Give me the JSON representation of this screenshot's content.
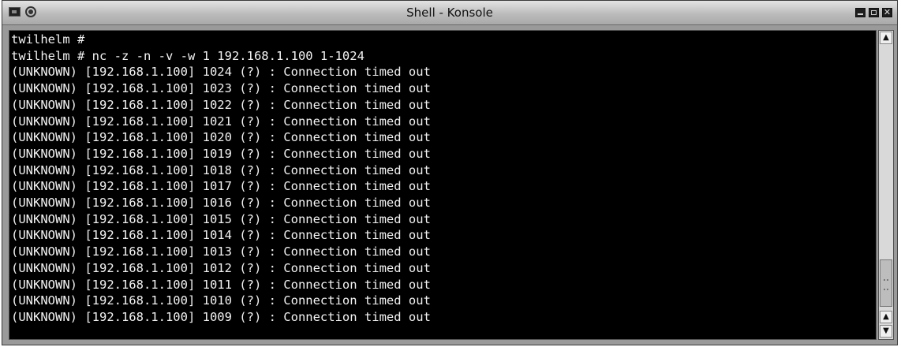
{
  "window": {
    "title": "Shell - Konsole",
    "controls": [
      "minimize",
      "maximize",
      "close"
    ],
    "close_glyph": "✕"
  },
  "terminal": {
    "lines": [
      "twilhelm #",
      "twilhelm # nc -z -n -v -w 1 192.168.1.100 1-1024",
      "(UNKNOWN) [192.168.1.100] 1024 (?) : Connection timed out",
      "(UNKNOWN) [192.168.1.100] 1023 (?) : Connection timed out",
      "(UNKNOWN) [192.168.1.100] 1022 (?) : Connection timed out",
      "(UNKNOWN) [192.168.1.100] 1021 (?) : Connection timed out",
      "(UNKNOWN) [192.168.1.100] 1020 (?) : Connection timed out",
      "(UNKNOWN) [192.168.1.100] 1019 (?) : Connection timed out",
      "(UNKNOWN) [192.168.1.100] 1018 (?) : Connection timed out",
      "(UNKNOWN) [192.168.1.100] 1017 (?) : Connection timed out",
      "(UNKNOWN) [192.168.1.100] 1016 (?) : Connection timed out",
      "(UNKNOWN) [192.168.1.100] 1015 (?) : Connection timed out",
      "(UNKNOWN) [192.168.1.100] 1014 (?) : Connection timed out",
      "(UNKNOWN) [192.168.1.100] 1013 (?) : Connection timed out",
      "(UNKNOWN) [192.168.1.100] 1012 (?) : Connection timed out",
      "(UNKNOWN) [192.168.1.100] 1011 (?) : Connection timed out",
      "(UNKNOWN) [192.168.1.100] 1010 (?) : Connection timed out",
      "(UNKNOWN) [192.168.1.100] 1009 (?) : Connection timed out"
    ],
    "colors": {
      "background": "#000000",
      "foreground": "#f2f2f2"
    }
  },
  "scrollbar": {
    "up_glyph": "▲",
    "down_glyph": "▼"
  }
}
